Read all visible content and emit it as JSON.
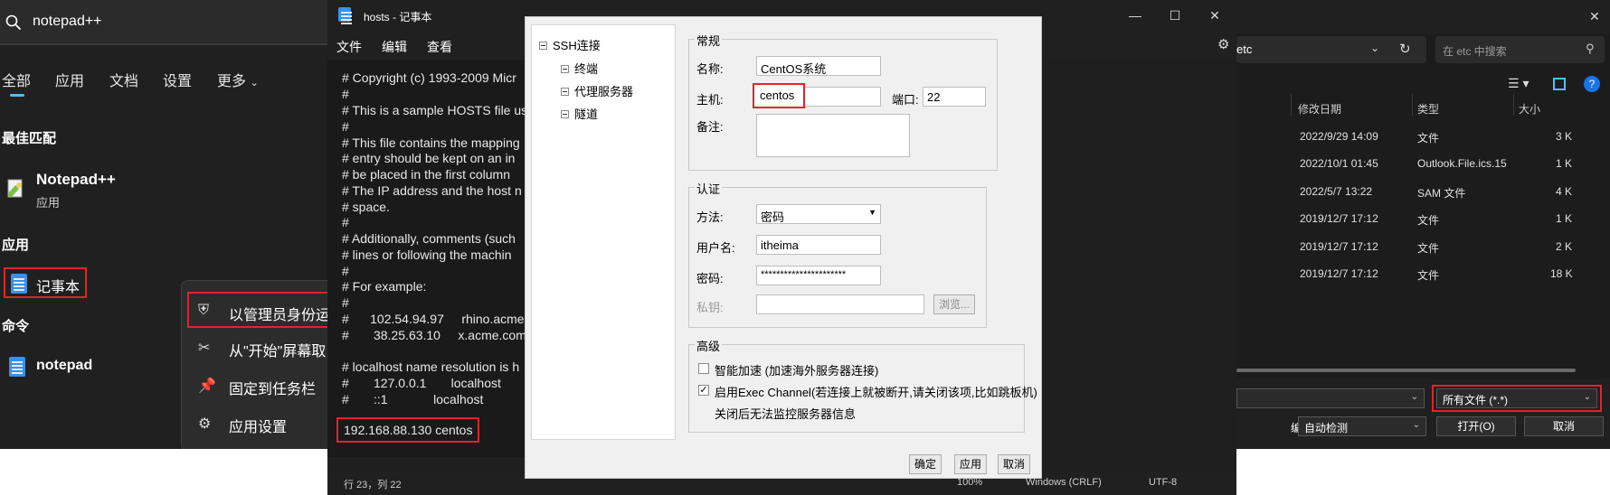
{
  "search_panel": {
    "query": "notepad++",
    "tabs": [
      "全部",
      "应用",
      "文档",
      "设置",
      "更多"
    ],
    "best_match_title": "最佳匹配",
    "best_match": {
      "name": "Notepad++",
      "type": "应用"
    },
    "apps_title": "应用",
    "app_notepad": "记事本",
    "commands_title": "命令",
    "command_notepad": "notepad",
    "context_menu": [
      "以管理员身份运",
      "从\"开始\"屏幕取",
      "固定到任务栏",
      "应用设置"
    ]
  },
  "notepad": {
    "title": "hosts - 记事本",
    "menu": [
      "文件",
      "编辑",
      "查看"
    ],
    "lines": [
      "# Copyright (c) 1993-2009 Micr",
      "#",
      "# This is a sample HOSTS file us",
      "#",
      "# This file contains the mapping",
      "# entry should be kept on an in",
      "# be placed in the first column",
      "# The IP address and the host n",
      "# space.",
      "#",
      "# Additionally, comments (such",
      "# lines or following the machin",
      "#",
      "# For example:",
      "#",
      "#      102.54.94.97     rhino.acme",
      "#       38.25.63.10     x.acme.com",
      "",
      "# localhost name resolution is h",
      "#       127.0.0.1       localhost",
      "#       ::1             localhost"
    ],
    "added_line": "192.168.88.130 centos",
    "status": {
      "position": "行 23，列 22",
      "zoom": "100%",
      "eol": "Windows (CRLF)",
      "encoding": "UTF-8"
    }
  },
  "ssh_dialog": {
    "tree": {
      "root": "SSH连接",
      "children": [
        "终端",
        "代理服务器",
        "隧道"
      ]
    },
    "general": {
      "title": "常规",
      "name_label": "名称:",
      "name_value": "CentOS系统",
      "host_label": "主机:",
      "host_value": "centos",
      "port_label": "端口:",
      "port_value": "22",
      "note_label": "备注:"
    },
    "auth": {
      "title": "认证",
      "method_label": "方法:",
      "method_value": "密码",
      "user_label": "用户名:",
      "user_value": "itheima",
      "password_label": "密码:",
      "password_value": "**********************",
      "key_label": "私钥:",
      "browse_label": "浏览..."
    },
    "advanced": {
      "title": "高级",
      "opt1": "智能加速 (加速海外服务器连接)",
      "opt2": "启用Exec Channel(若连接上就被断开,请关闭该项,比如跳板机)",
      "opt2_note": "关闭后无法监控服务器信息",
      "opt1_checked": false,
      "opt2_checked": true
    },
    "buttons": {
      "ok": "确定",
      "apply": "应用",
      "cancel": "取消"
    }
  },
  "explorer": {
    "address": "etc",
    "search_placeholder": "在 etc 中搜索",
    "columns": [
      "修改日期",
      "类型",
      "大小"
    ],
    "rows": [
      {
        "date": "2022/9/29 14:09",
        "type": "文件",
        "size": "3 K"
      },
      {
        "date": "2022/10/1 01:45",
        "type": "Outlook.File.ics.15",
        "size": "1 K"
      },
      {
        "date": "2022/5/7 13:22",
        "type": "SAM 文件",
        "size": "4 K"
      },
      {
        "date": "2019/12/7 17:12",
        "type": "文件",
        "size": "1 K"
      },
      {
        "date": "2019/12/7 17:12",
        "type": "文件",
        "size": "2 K"
      },
      {
        "date": "2019/12/7 17:12",
        "type": "文件",
        "size": "18 K"
      }
    ],
    "filter": "所有文件  (*.*)",
    "encoding_label": "编码:",
    "encoding_value": "自动检测",
    "open_button": "打开(O)",
    "cancel_button": "取消"
  }
}
